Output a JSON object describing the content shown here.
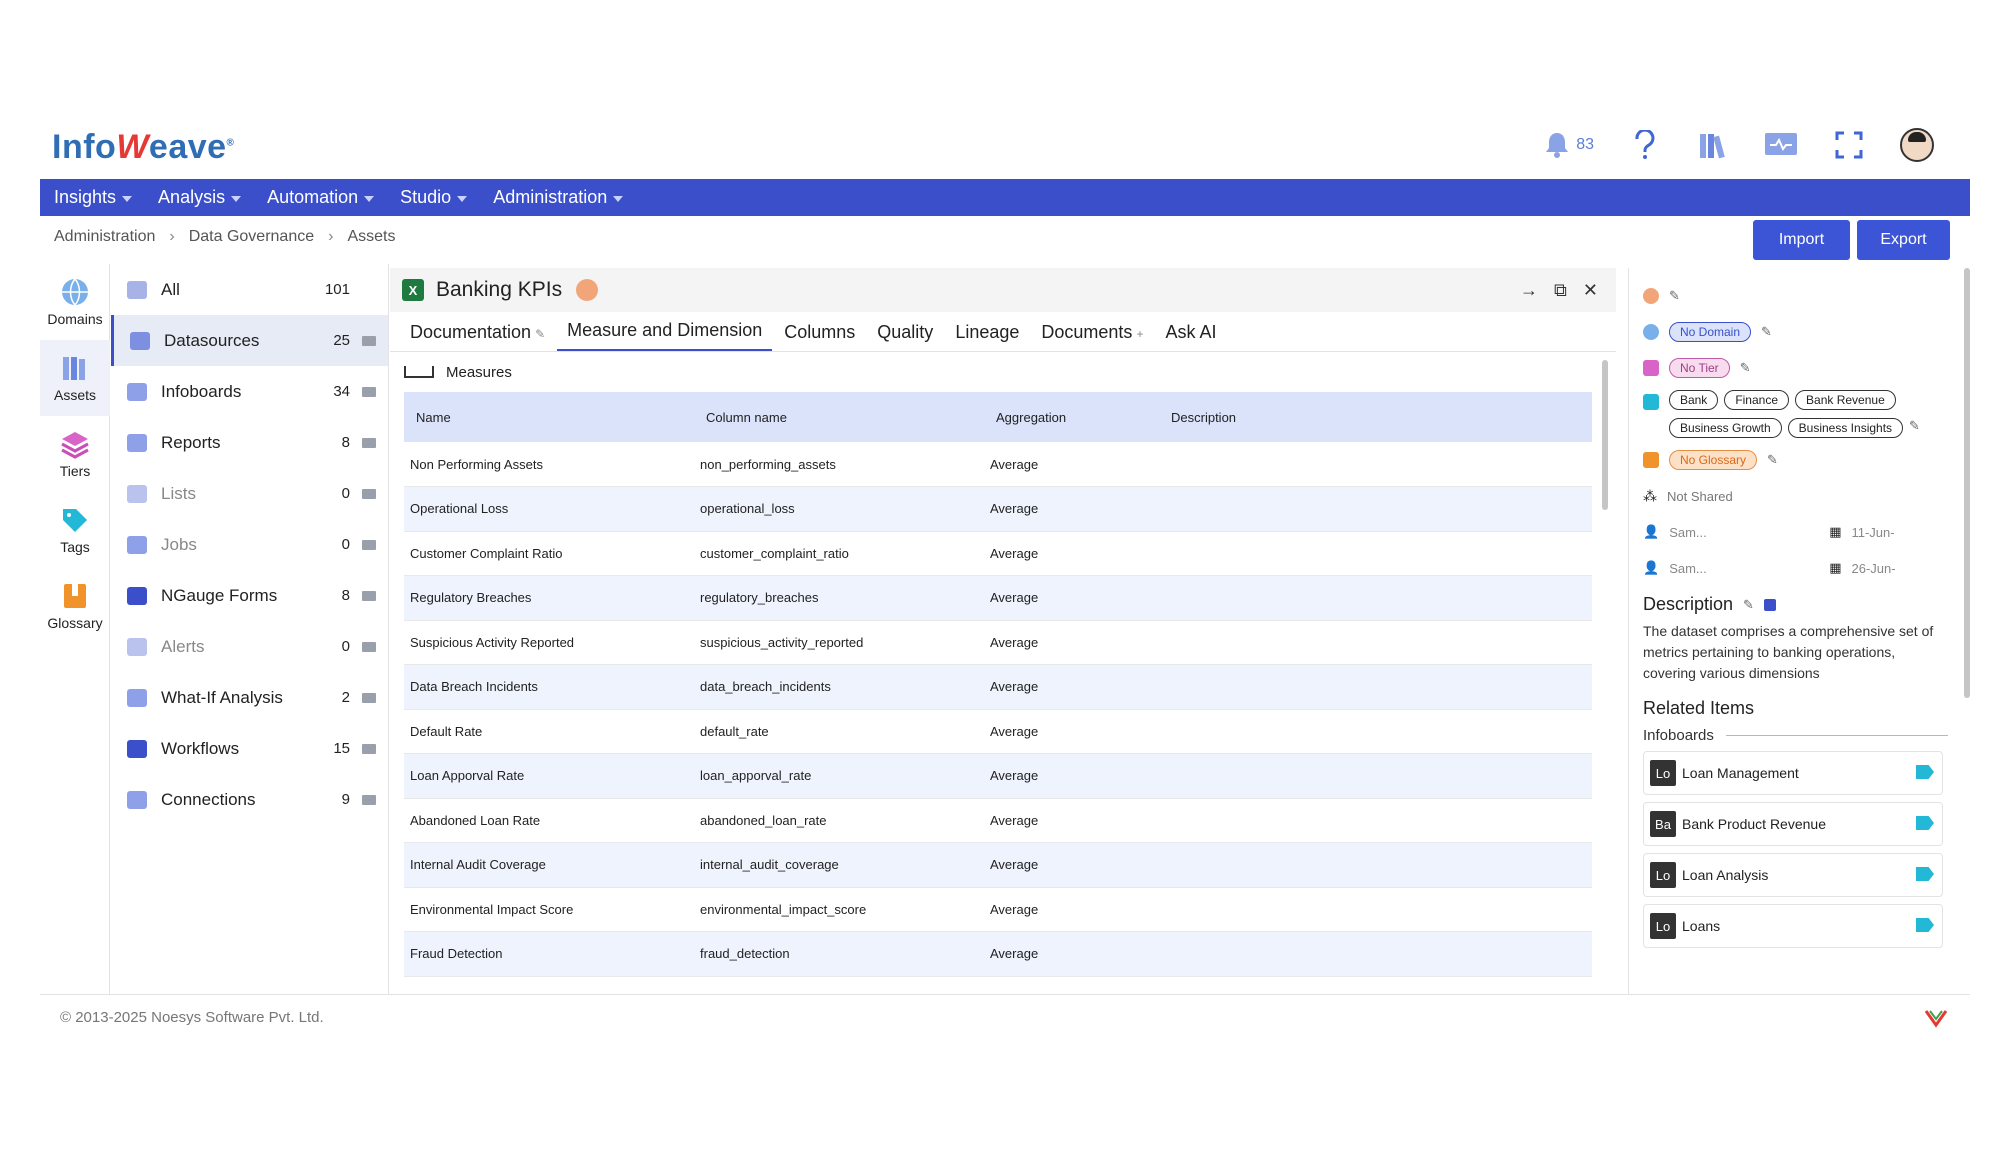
{
  "brand": {
    "name_prefix": "Info",
    "name_suffix": "eave",
    "name_w": "W",
    "reg": "®"
  },
  "topbar": {
    "notification_count": "83"
  },
  "nav": [
    {
      "label": "Insights"
    },
    {
      "label": "Analysis"
    },
    {
      "label": "Automation"
    },
    {
      "label": "Studio"
    },
    {
      "label": "Administration"
    }
  ],
  "breadcrumb": [
    "Administration",
    "Data Governance",
    "Assets"
  ],
  "actions": {
    "import": "Import",
    "export": "Export"
  },
  "rail": [
    {
      "label": "Domains",
      "color": "#3b82d6"
    },
    {
      "label": "Assets",
      "color": "#6a7fd9"
    },
    {
      "label": "Tiers",
      "color": "#c94fb8"
    },
    {
      "label": "Tags",
      "color": "#22b8d6"
    },
    {
      "label": "Glossary",
      "color": "#f0932b"
    }
  ],
  "assets": [
    {
      "label": "All",
      "count": "101",
      "color": "#a7b3e6"
    },
    {
      "label": "Datasources",
      "count": "25",
      "color": "#7c8fe0"
    },
    {
      "label": "Infoboards",
      "count": "34",
      "color": "#8ea0e8"
    },
    {
      "label": "Reports",
      "count": "8",
      "color": "#8ea0e8"
    },
    {
      "label": "Lists",
      "count": "0",
      "color": "#b9c3ee"
    },
    {
      "label": "Jobs",
      "count": "0",
      "color": "#8ea0e8"
    },
    {
      "label": "NGauge Forms",
      "count": "8",
      "color": "#3a4fc9"
    },
    {
      "label": "Alerts",
      "count": "0",
      "color": "#b9c3ee"
    },
    {
      "label": "What-If Analysis",
      "count": "2",
      "color": "#8ea0e8"
    },
    {
      "label": "Workflows",
      "count": "15",
      "color": "#3a4fc9"
    },
    {
      "label": "Connections",
      "count": "9",
      "color": "#8ea0e8"
    }
  ],
  "dataset": {
    "title": "Banking KPIs",
    "excel_label": "X"
  },
  "tabs": [
    "Documentation",
    "Measure and Dimension",
    "Columns",
    "Quality",
    "Lineage",
    "Documents",
    "Ask AI"
  ],
  "measures": {
    "heading": "Measures",
    "columns": [
      "Name",
      "Column name",
      "Aggregation",
      "Description"
    ],
    "rows": [
      [
        "Non Performing Assets",
        "non_performing_assets",
        "Average",
        ""
      ],
      [
        "Operational Loss",
        "operational_loss",
        "Average",
        ""
      ],
      [
        "Customer Complaint Ratio",
        "customer_complaint_ratio",
        "Average",
        ""
      ],
      [
        "Regulatory Breaches",
        "regulatory_breaches",
        "Average",
        ""
      ],
      [
        "Suspicious Activity Reported",
        "suspicious_activity_reported",
        "Average",
        ""
      ],
      [
        "Data Breach Incidents",
        "data_breach_incidents",
        "Average",
        ""
      ],
      [
        "Default Rate",
        "default_rate",
        "Average",
        ""
      ],
      [
        "Loan Apporval Rate",
        "loan_apporval_rate",
        "Average",
        ""
      ],
      [
        "Abandoned Loan Rate",
        "abandoned_loan_rate",
        "Average",
        ""
      ],
      [
        "Internal Audit Coverage",
        "internal_audit_coverage",
        "Average",
        ""
      ],
      [
        "Environmental Impact Score",
        "environmental_impact_score",
        "Average",
        ""
      ],
      [
        "Fraud Detection",
        "fraud_detection",
        "Average",
        ""
      ]
    ]
  },
  "side": {
    "domain": "No Domain",
    "tier": "No Tier",
    "tags": [
      "Bank",
      "Finance",
      "Bank Revenue",
      "Business Growth",
      "Business Insights"
    ],
    "glossary": "No Glossary",
    "shared": "Not Shared",
    "created_by": "Sam...",
    "created_date": "11-Jun-",
    "modified_by": "Sam...",
    "modified_date": "26-Jun-",
    "description_title": "Description",
    "description": "The dataset comprises a comprehensive set of metrics pertaining to banking operations, covering various dimensions",
    "related_title": "Related Items",
    "related_group": "Infoboards",
    "related": [
      {
        "badge": "Lo",
        "label": "Loan Management"
      },
      {
        "badge": "Ba",
        "label": "Bank Product Revenue"
      },
      {
        "badge": "Lo",
        "label": "Loan Analysis"
      },
      {
        "badge": "Lo",
        "label": "Loans"
      }
    ]
  },
  "footer": {
    "copyright": "© 2013-2025 Noesys Software Pvt. Ltd."
  }
}
